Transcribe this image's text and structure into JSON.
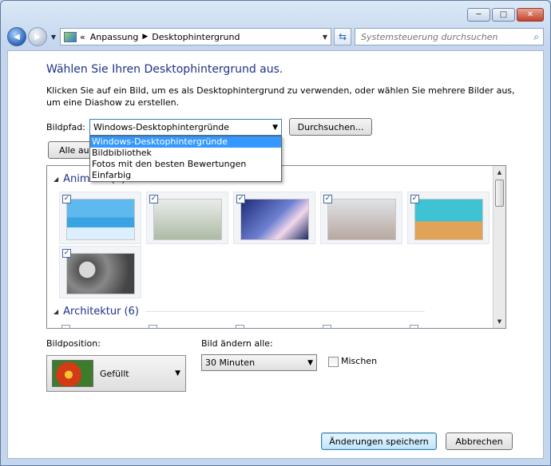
{
  "window": {
    "caption": {
      "minimize": "─",
      "maximize": "□",
      "close": "✕"
    }
  },
  "nav": {
    "back_glyph": "◀",
    "forward_glyph": "▶",
    "breadcrumb_prefix": "«",
    "breadcrumbs": [
      "Anpassung",
      "Desktophintergrund"
    ],
    "search_placeholder": "Systemsteuerung durchsuchen"
  },
  "main": {
    "heading": "Wählen Sie Ihren Desktophintergrund aus.",
    "description": "Klicken Sie auf ein Bild, um es als Desktophintergrund zu verwenden, oder wählen Sie mehrere Bilder aus, um eine Diashow zu erstellen.",
    "bildpfad_label": "Bildpfad:",
    "bildpfad_value": "Windows-Desktophintergründe",
    "browse_button": "Durchsuchen...",
    "select_all_button": "Alle aus",
    "bildpfad_options": [
      "Windows-Desktophintergründe",
      "Bildbibliothek",
      "Fotos mit den besten Bewertungen",
      "Einfarbig"
    ],
    "selected_option_index": 0
  },
  "gallery": {
    "groups": [
      {
        "name": "Animiert (6)"
      },
      {
        "name": "Architektur (6)"
      }
    ],
    "check_glyph": "✓"
  },
  "bottom": {
    "position_label": "Bildposition:",
    "position_value": "Gefüllt",
    "interval_label": "Bild ändern alle:",
    "interval_value": "30 Minuten",
    "shuffle_label": "Mischen",
    "shuffle_checked": false,
    "save_button": "Änderungen speichern",
    "cancel_button": "Abbrechen"
  }
}
